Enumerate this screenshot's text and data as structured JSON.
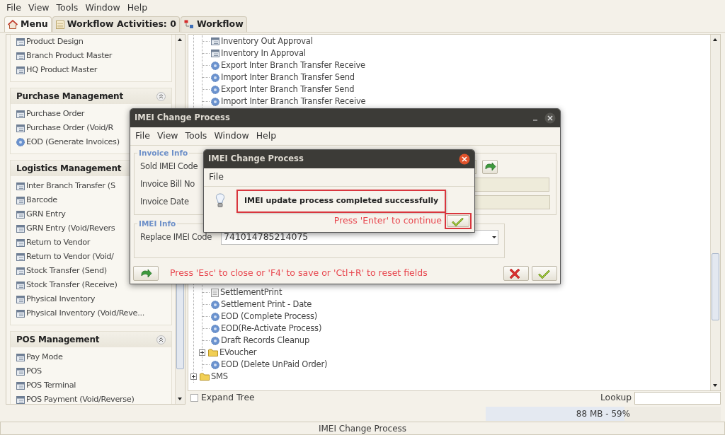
{
  "menubar": [
    "File",
    "View",
    "Tools",
    "Window",
    "Help"
  ],
  "tabs": [
    {
      "label": "Menu",
      "selected": true
    },
    {
      "label": "Workflow Activities: 0",
      "selected": false
    },
    {
      "label": "Workflow",
      "selected": false
    }
  ],
  "sidebar": {
    "sections": [
      {
        "items": [
          {
            "label": "Product Design",
            "kind": "form"
          },
          {
            "label": "Branch Product Master",
            "kind": "form"
          },
          {
            "label": "HQ Product Master",
            "kind": "form"
          }
        ]
      },
      {
        "title": "Purchase Management",
        "collapse_button": true,
        "items": [
          {
            "label": "Purchase Order",
            "kind": "form"
          },
          {
            "label": "Purchase Order (Void/R",
            "kind": "form"
          },
          {
            "label": "EOD (Generate Invoices)",
            "kind": "process"
          }
        ]
      },
      {
        "title": "Logistics Management",
        "items": [
          {
            "label": "Inter Branch Transfer (S",
            "kind": "form"
          },
          {
            "label": "Barcode",
            "kind": "form"
          },
          {
            "label": "GRN Entry",
            "kind": "form"
          },
          {
            "label": "GRN Entry (Void/Revers",
            "kind": "form"
          },
          {
            "label": "Return to Vendor",
            "kind": "form"
          },
          {
            "label": "Return to Vendor (Void/",
            "kind": "form"
          },
          {
            "label": "Stock Transfer (Send)",
            "kind": "form"
          },
          {
            "label": "Stock Transfer (Receive)",
            "kind": "form"
          },
          {
            "label": "Physical Inventory",
            "kind": "form"
          },
          {
            "label": "Physical Inventory (Void/Reve...",
            "kind": "form"
          }
        ]
      },
      {
        "title": "POS Management",
        "collapse_button": true,
        "items": [
          {
            "label": "Pay Mode",
            "kind": "form"
          },
          {
            "label": "POS",
            "kind": "form"
          },
          {
            "label": "POS Terminal",
            "kind": "form"
          },
          {
            "label": "POS Payment (Void/Reverse)",
            "kind": "form"
          }
        ]
      }
    ]
  },
  "tree": {
    "upper_items": [
      {
        "label": "Inventory Out Approval",
        "kind": "form"
      },
      {
        "label": "Inventory In Approval",
        "kind": "form"
      },
      {
        "label": "Export Inter Branch Transfer Receive",
        "kind": "process"
      },
      {
        "label": "Import Inter Branch Transfer Send",
        "kind": "process"
      },
      {
        "label": "Export Inter Branch Transfer Send",
        "kind": "process"
      },
      {
        "label": "Import Inter Branch Transfer Receive",
        "kind": "process"
      }
    ],
    "lower_items": [
      {
        "label": "SettlementPrint",
        "kind": "report"
      },
      {
        "label": "Settlement Print - Date",
        "kind": "process"
      },
      {
        "label": "EOD (Complete Process)",
        "kind": "process"
      },
      {
        "label": "EOD(Re-Activate Process)",
        "kind": "process"
      },
      {
        "label": "Draft Records Cleanup",
        "kind": "process"
      },
      {
        "label": "EVoucher",
        "kind": "folder",
        "expanded": false
      },
      {
        "label": "EOD (Delete UnPaid Order)",
        "kind": "process"
      }
    ],
    "root_items": [
      {
        "label": "SMS",
        "kind": "folder",
        "expanded": false
      }
    ]
  },
  "expand_tree": {
    "label": "Expand Tree",
    "checked": false
  },
  "lookup": {
    "label": "Lookup"
  },
  "memory": {
    "reading": "88 MB - 59%",
    "level": 0.59
  },
  "status_bar": "IMEI Change Process",
  "change_dialog": {
    "title": "IMEI Change Process",
    "menubar": [
      "File",
      "View",
      "Tools",
      "Window",
      "Help"
    ],
    "invoice_info": {
      "legend": "Invoice Info",
      "fields": [
        {
          "label": "Sold IMEI Code",
          "kind": "lookup"
        },
        {
          "label": "Invoice Bill No",
          "kind": "text"
        },
        {
          "label": "Invoice Date",
          "kind": "text"
        }
      ]
    },
    "imei_info": {
      "legend": "IMEI Info",
      "field": {
        "label": "Replace IMEI Code",
        "value": "741014785214075"
      }
    },
    "hint": "Press 'Esc' to close or 'F4' to save or 'Ctl+R' to reset fields"
  },
  "message_dialog": {
    "title": "IMEI Change Process",
    "menubar": [
      "File"
    ],
    "message": "IMEI update process completed successfully",
    "hint": "Press 'Enter' to continue"
  }
}
